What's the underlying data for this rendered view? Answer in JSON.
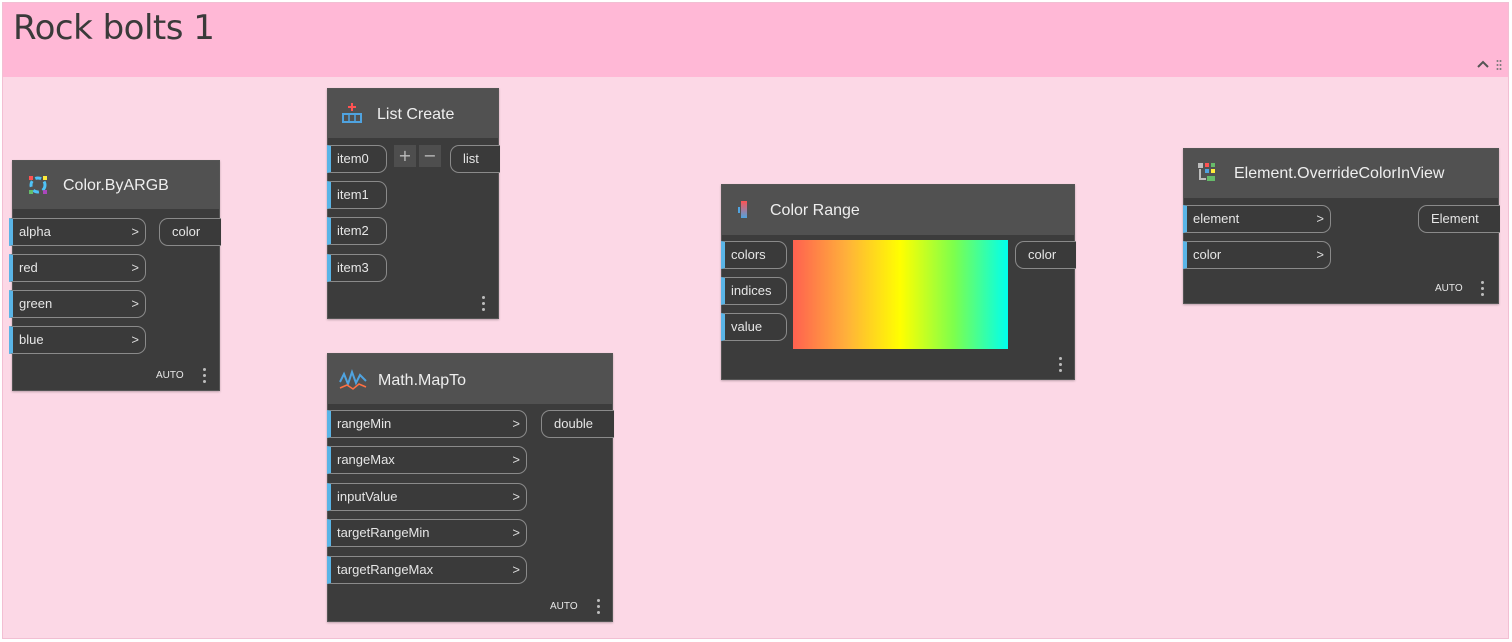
{
  "group": {
    "title": "Rock bolts 1"
  },
  "nodes": {
    "color_byargb": {
      "title": "Color.ByARGB",
      "inputs": [
        "alpha",
        "red",
        "green",
        "blue"
      ],
      "output": "color",
      "lacing": "AUTO"
    },
    "list_create": {
      "title": "List Create",
      "inputs": [
        "item0",
        "item1",
        "item2",
        "item3"
      ],
      "output": "list",
      "add_label": "+",
      "remove_label": "−"
    },
    "math_mapto": {
      "title": "Math.MapTo",
      "inputs": [
        "rangeMin",
        "rangeMax",
        "inputValue",
        "targetRangeMin",
        "targetRangeMax"
      ],
      "output": "double",
      "lacing": "AUTO"
    },
    "color_range": {
      "title": "Color Range",
      "inputs": [
        "colors",
        "indices",
        "value"
      ],
      "output": "color",
      "gradient_colors": [
        "#ff6150",
        "#ffb13a",
        "#ffff00",
        "#7cff4d",
        "#00ffee"
      ]
    },
    "element_override": {
      "title": "Element.OverrideColorInView",
      "inputs": [
        "element",
        "color"
      ],
      "output": "Element",
      "lacing": "AUTO"
    }
  },
  "icons": {
    "collapse": "chevron-up-icon",
    "grip": "grip-icon",
    "port_arrow": ">"
  },
  "colors": {
    "group_background": "#fcd8e6",
    "group_header": "#ffb8d6",
    "node_body": "#3c3c3c",
    "node_header": "#515151",
    "port_marker": "#5ab4e6"
  }
}
